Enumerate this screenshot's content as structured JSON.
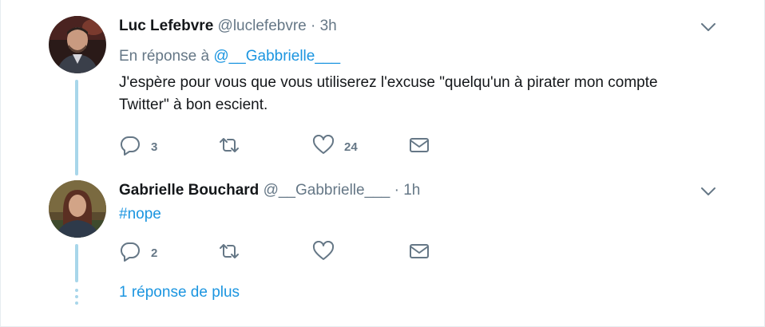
{
  "tweets": [
    {
      "name": "Luc Lefebvre",
      "handle": "@luclefebvre",
      "separator": "·",
      "time": "3h",
      "reply_prefix": "En réponse à",
      "reply_handle": "@__Gabbrielle___",
      "text": "J'espère pour vous que vous utiliserez l'excuse \"quelqu'un à pirater mon compte Twitter\" à bon escient.",
      "reply_count": "3",
      "retweet_count": "",
      "like_count": "24"
    },
    {
      "name": "Gabrielle Bouchard",
      "handle": "@__Gabbrielle___",
      "separator": "·",
      "time": "1h",
      "hashtag": "#nope",
      "reply_count": "2",
      "retweet_count": "",
      "like_count": ""
    }
  ],
  "more_replies": "1 réponse de plus",
  "icons": {
    "reply": "reply-icon",
    "retweet": "retweet-icon",
    "like": "heart-icon",
    "message": "envelope-icon",
    "menu": "chevron-down-icon"
  },
  "colors": {
    "link": "#1b95e0",
    "muted": "#657786",
    "thread_line": "#a8d6ea",
    "text": "#14171a"
  }
}
